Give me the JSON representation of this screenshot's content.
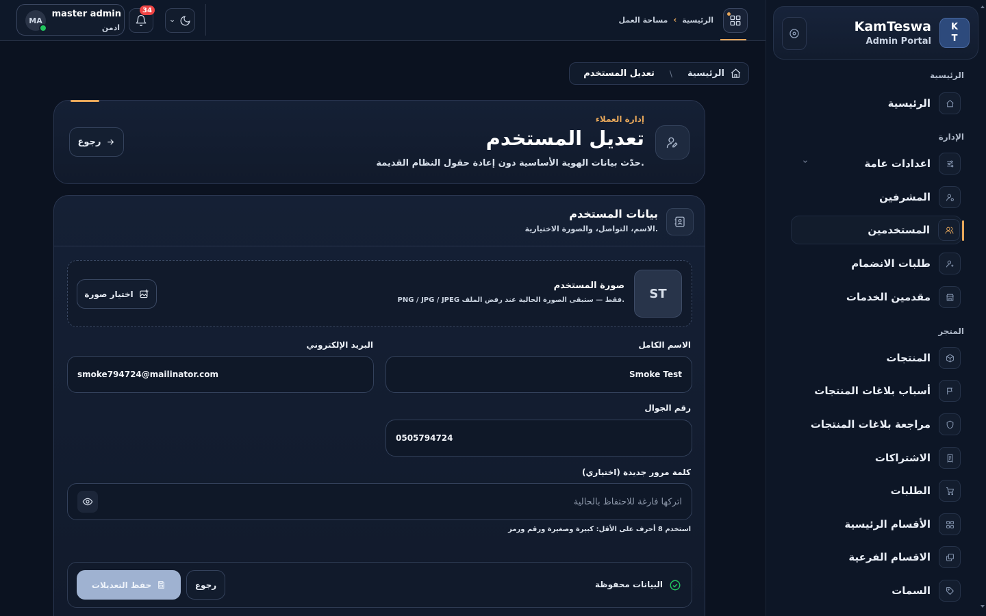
{
  "brand": {
    "badge_line1": "K",
    "badge_line2": "T",
    "title": "KamTeswa",
    "subtitle": "Admin Portal"
  },
  "sidebar": {
    "sections": {
      "home": "الرئيسية",
      "admin": "الإدارة",
      "store": "المتجر"
    },
    "items": [
      {
        "label": "الرئيسية",
        "icon": "home-icon"
      },
      {
        "label": "اعدادات عامة",
        "icon": "sliders-icon",
        "has_chevron": true
      },
      {
        "label": "المشرفين",
        "icon": "user-cog-icon"
      },
      {
        "label": "المستخدمين",
        "icon": "users-icon",
        "active": true
      },
      {
        "label": "طلبات الانضمام",
        "icon": "user-plus-icon"
      },
      {
        "label": "مقدمين الخدمات",
        "icon": "store-icon"
      },
      {
        "label": "المنتجات",
        "icon": "box-icon"
      },
      {
        "label": "أسباب بلاغات المنتجات",
        "icon": "flag-icon"
      },
      {
        "label": "مراجعة بلاغات المنتجات",
        "icon": "shield-icon"
      },
      {
        "label": "الاشتراكات",
        "icon": "receipt-icon"
      },
      {
        "label": "الطلبات",
        "icon": "cart-icon"
      },
      {
        "label": "الأقسام الرئيسية",
        "icon": "grid-icon"
      },
      {
        "label": "الاقسام الفرعية",
        "icon": "layers-icon"
      },
      {
        "label": "السمات",
        "icon": "tag-icon"
      }
    ]
  },
  "topbar": {
    "user_initials": "MA",
    "user_name": "master admin",
    "user_role": "ادمن",
    "notification_count": "34",
    "breadcrumb": {
      "home": "الرئيسية",
      "current": "مساحة العمل"
    }
  },
  "breadcrumb": {
    "home": "الرئيسية",
    "current": "تعديل المستخدم"
  },
  "header": {
    "kicker": "إدارة العملاء",
    "title": "تعديل المستخدم",
    "subtitle": "حدّث بيانات الهوية الأساسية دون إعادة حقول النظام القديمة.",
    "back_label": "رجوع"
  },
  "form": {
    "section_title": "بيانات المستخدم",
    "section_subtitle": "الاسم، التواصل، والصورة الاختيارية.",
    "photo": {
      "initials": "ST",
      "title": "صورة المستخدم",
      "hint": "PNG / JPG / JPEG فقط — ستبقى الصورة الحالية عند رفض الملف.",
      "choose_label": "اختيار صورة"
    },
    "full_name": {
      "label": "الاسم الكامل",
      "value": "Smoke Test"
    },
    "email": {
      "label": "البريد الإلكتروني",
      "value": "smoke794724@mailinator.com"
    },
    "phone": {
      "label": "رقم الجوال",
      "value": "0505794724"
    },
    "password": {
      "label": "كلمة مرور جديدة (اختياري)",
      "placeholder": "اتركها فارغة للاحتفاظ بالحالية",
      "hint": "استخدم 8 أحرف على الأقل: كبيرة وصغيرة ورقم ورمز"
    },
    "footer": {
      "status": "البيانات محفوظة",
      "back_label": "رجوع",
      "save_label": "حفظ التعديلات"
    }
  },
  "colors": {
    "accent": "#e7a75a",
    "background": "#0b1220",
    "success": "#22c55e",
    "danger": "#ef4444"
  }
}
